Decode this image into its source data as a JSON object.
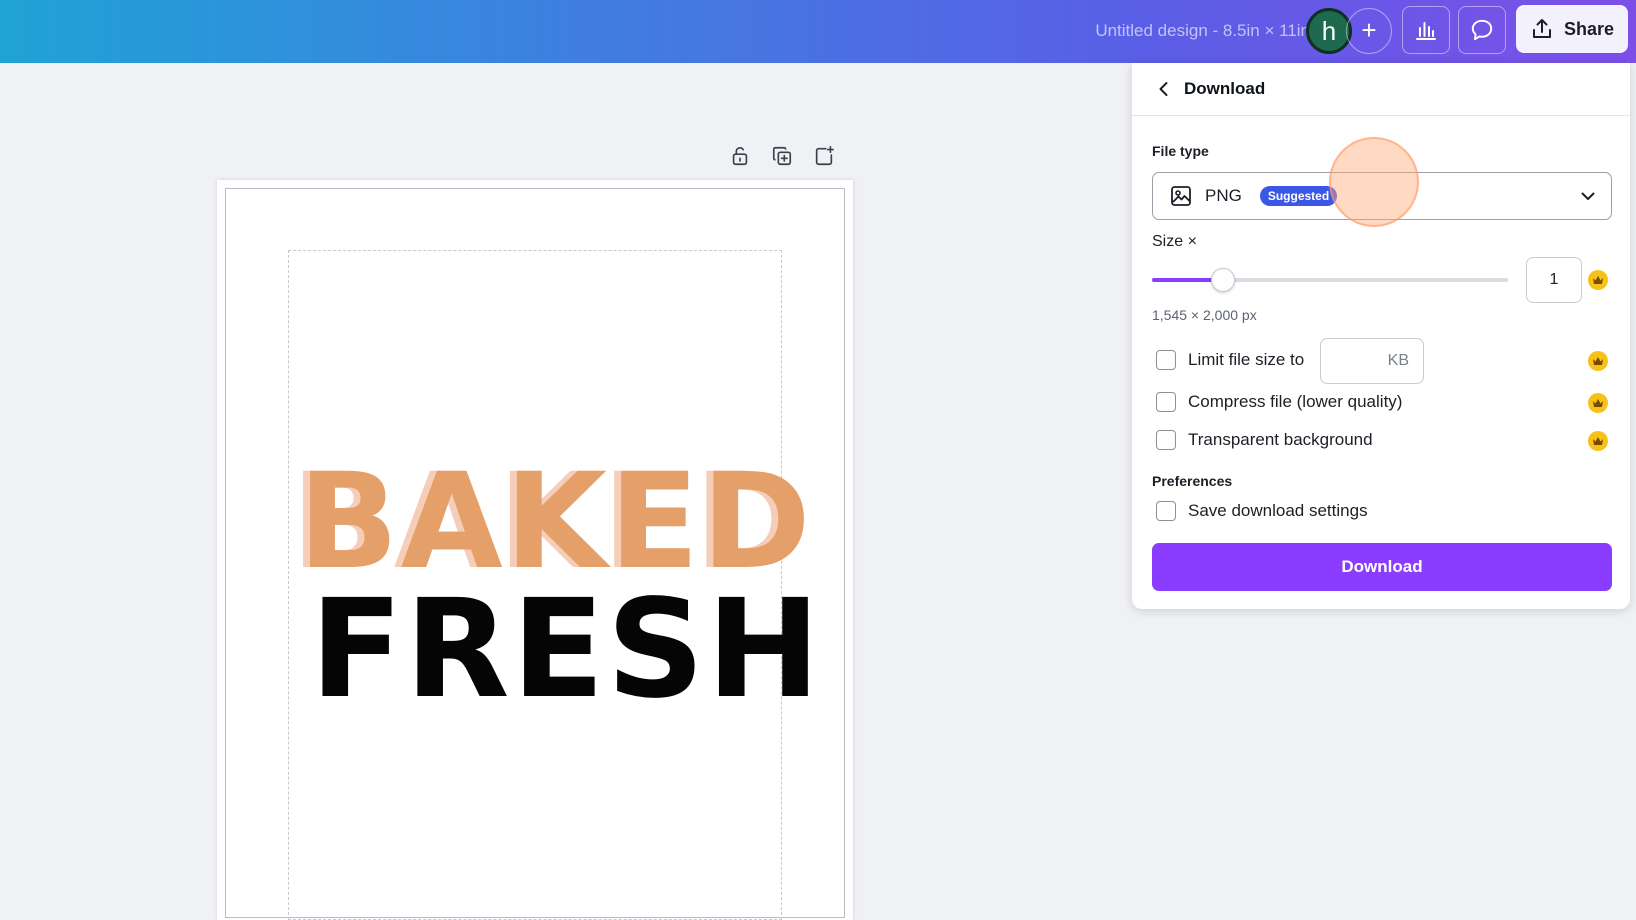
{
  "topbar": {
    "doc_title": "Untitled design - 8.5in × 11in",
    "avatar_letter": "h",
    "add_label": "+",
    "share_label": "Share",
    "icons": [
      "plus-icon",
      "bar-chart-icon",
      "comment-icon",
      "share-upload-icon"
    ]
  },
  "canvas": {
    "line1": "BAKED",
    "line2": "FRESH",
    "line1_color": "#e5a06a",
    "line1_shadow_color": "#f6cdb8",
    "line2_color": "#050505",
    "tools": [
      "unlock-icon",
      "duplicate-icon",
      "add-page-icon"
    ]
  },
  "download_panel": {
    "title": "Download",
    "file_type_label": "File type",
    "file_type_value": "PNG",
    "suggested_badge": "Suggested",
    "size_label": "Size ×",
    "size_value": "1",
    "size_fraction": 0.2,
    "dimensions": "1,545 × 2,000 px",
    "limit_label": "Limit file size to",
    "kb_unit": "KB",
    "compress_label": "Compress file (lower quality)",
    "transparent_label": "Transparent background",
    "preferences_label": "Preferences",
    "save_settings_label": "Save download settings",
    "download_button": "Download",
    "accent_color": "#8b3dff",
    "badge_color": "#3b57e8",
    "crown_color": "#f5c21a"
  }
}
